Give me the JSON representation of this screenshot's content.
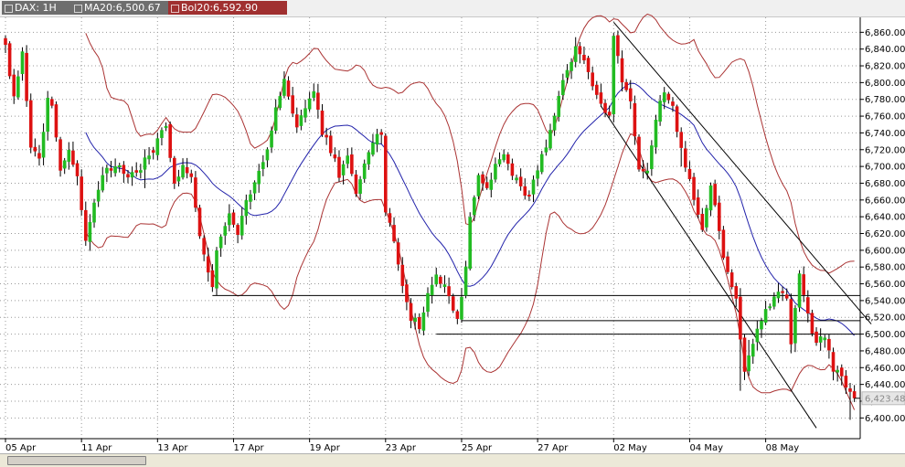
{
  "tabs": [
    {
      "id": "symbol",
      "label": "DAX: 1H",
      "color": "#6e6e6e"
    },
    {
      "id": "ma",
      "label": "MA20:6,500.67",
      "color": "#6e6e6e"
    },
    {
      "id": "bol",
      "label": "Bol20:6,592.90",
      "color": "#a03030"
    }
  ],
  "last_price_label": "6,423.48",
  "colors": {
    "up": "#22bb22",
    "down": "#dd1111",
    "ma": "#2222aa",
    "bollinger": "#aa3333",
    "lines": "#000000"
  },
  "chart_data": {
    "type": "candlestick",
    "symbol": "DAX",
    "interval": "1H",
    "ylim": [
      6390,
      6880
    ],
    "y_ticks": [
      6400,
      6420,
      6440,
      6460,
      6480,
      6500,
      6520,
      6540,
      6560,
      6580,
      6600,
      6620,
      6640,
      6660,
      6680,
      6700,
      6720,
      6740,
      6760,
      6780,
      6800,
      6820,
      6840,
      6860
    ],
    "y_tick_labels": [
      "6,400.00",
      "6,420.00",
      "6,440.00",
      "6,460.00",
      "6,480.00",
      "6,500.00",
      "6,520.00",
      "6,540.00",
      "6,560.00",
      "6,580.00",
      "6,600.00",
      "6,620.00",
      "6,640.00",
      "6,660.00",
      "6,680.00",
      "6,700.00",
      "6,720.00",
      "6,740.00",
      "6,760.00",
      "6,780.00",
      "6,800.00",
      "6,820.00",
      "6,840.00",
      "6,860.00"
    ],
    "x_labels": [
      {
        "label": "05 Apr",
        "bar": 0
      },
      {
        "label": "11 Apr",
        "bar": 18
      },
      {
        "label": "13 Apr",
        "bar": 36
      },
      {
        "label": "17 Apr",
        "bar": 54
      },
      {
        "label": "19 Apr",
        "bar": 72
      },
      {
        "label": "23 Apr",
        "bar": 90
      },
      {
        "label": "25 Apr",
        "bar": 108
      },
      {
        "label": "27 Apr",
        "bar": 126
      },
      {
        "label": "02 May",
        "bar": 144
      },
      {
        "label": "04 May",
        "bar": 162
      },
      {
        "label": "08 May",
        "bar": 180
      }
    ],
    "grid": true,
    "anchors": [
      [
        0,
        6845
      ],
      [
        2,
        6780
      ],
      [
        4,
        6840
      ],
      [
        6,
        6720
      ],
      [
        8,
        6708
      ],
      [
        10,
        6780
      ],
      [
        11,
        6770
      ],
      [
        13,
        6700
      ],
      [
        15,
        6720
      ],
      [
        17,
        6690
      ],
      [
        19,
        6610
      ],
      [
        21,
        6660
      ],
      [
        23,
        6690
      ],
      [
        26,
        6700
      ],
      [
        29,
        6690
      ],
      [
        32,
        6700
      ],
      [
        35,
        6720
      ],
      [
        38,
        6750
      ],
      [
        40,
        6680
      ],
      [
        42,
        6700
      ],
      [
        44,
        6690
      ],
      [
        46,
        6620
      ],
      [
        48,
        6570
      ],
      [
        49,
        6555
      ],
      [
        50,
        6600
      ],
      [
        53,
        6640
      ],
      [
        55,
        6620
      ],
      [
        57,
        6660
      ],
      [
        60,
        6690
      ],
      [
        62,
        6720
      ],
      [
        64,
        6770
      ],
      [
        66,
        6805
      ],
      [
        67,
        6780
      ],
      [
        69,
        6750
      ],
      [
        71,
        6770
      ],
      [
        73,
        6790
      ],
      [
        75,
        6740
      ],
      [
        77,
        6720
      ],
      [
        79,
        6690
      ],
      [
        81,
        6710
      ],
      [
        83,
        6670
      ],
      [
        85,
        6700
      ],
      [
        87,
        6730
      ],
      [
        89,
        6740
      ],
      [
        90,
        6650
      ],
      [
        92,
        6610
      ],
      [
        94,
        6560
      ],
      [
        96,
        6520
      ],
      [
        98,
        6510
      ],
      [
        100,
        6550
      ],
      [
        102,
        6570
      ],
      [
        104,
        6560
      ],
      [
        106,
        6530
      ],
      [
        107,
        6515
      ],
      [
        109,
        6580
      ],
      [
        110,
        6640
      ],
      [
        112,
        6690
      ],
      [
        114,
        6670
      ],
      [
        116,
        6700
      ],
      [
        118,
        6715
      ],
      [
        120,
        6690
      ],
      [
        122,
        6680
      ],
      [
        124,
        6660
      ],
      [
        126,
        6700
      ],
      [
        128,
        6720
      ],
      [
        130,
        6760
      ],
      [
        132,
        6800
      ],
      [
        134,
        6820
      ],
      [
        135,
        6840
      ],
      [
        137,
        6830
      ],
      [
        139,
        6800
      ],
      [
        141,
        6770
      ],
      [
        143,
        6760
      ],
      [
        144,
        6860
      ],
      [
        146,
        6800
      ],
      [
        148,
        6780
      ],
      [
        150,
        6700
      ],
      [
        152,
        6690
      ],
      [
        154,
        6760
      ],
      [
        156,
        6790
      ],
      [
        158,
        6770
      ],
      [
        160,
        6720
      ],
      [
        162,
        6680
      ],
      [
        164,
        6640
      ],
      [
        165,
        6620
      ],
      [
        167,
        6680
      ],
      [
        168,
        6650
      ],
      [
        170,
        6590
      ],
      [
        172,
        6560
      ],
      [
        173,
        6545
      ],
      [
        174,
        6490
      ],
      [
        175,
        6460
      ],
      [
        177,
        6490
      ],
      [
        179,
        6520
      ],
      [
        181,
        6535
      ],
      [
        183,
        6550
      ],
      [
        185,
        6545
      ],
      [
        186,
        6485
      ],
      [
        188,
        6575
      ],
      [
        190,
        6520
      ],
      [
        192,
        6490
      ],
      [
        194,
        6500
      ],
      [
        196,
        6460
      ],
      [
        198,
        6445
      ],
      [
        200,
        6430
      ],
      [
        201,
        6423.48
      ]
    ],
    "horizontal_lines": [
      {
        "x_bars": [
          49,
          205
        ],
        "y": 6546
      },
      {
        "x_bars": [
          108,
          205
        ],
        "y": 6516
      },
      {
        "x_bars": [
          102,
          205
        ],
        "y": 6500
      }
    ],
    "trend_lines": [
      {
        "from": [
          144,
          6872
        ],
        "to": [
          205,
          6512
        ]
      },
      {
        "from": [
          141,
          6772
        ],
        "to": [
          192,
          6388
        ]
      }
    ]
  }
}
